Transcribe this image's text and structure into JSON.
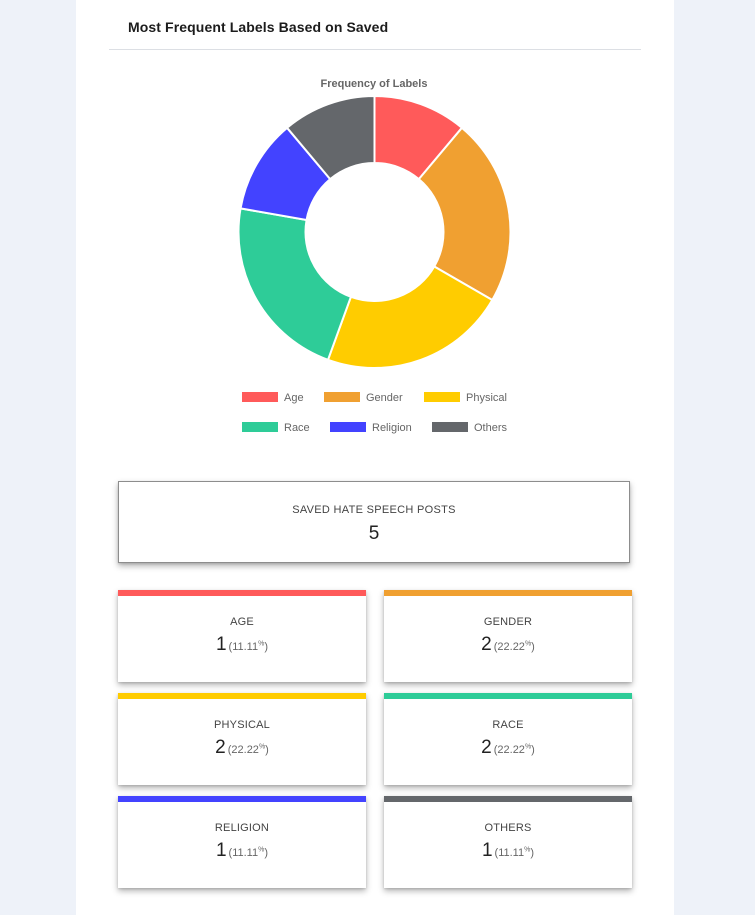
{
  "panel": {
    "title": "Most Frequent Labels Based on Saved"
  },
  "chart_data": {
    "type": "pie",
    "variant": "donut",
    "title": "Frequency of Labels",
    "labels": [
      "Age",
      "Gender",
      "Physical",
      "Race",
      "Religion",
      "Others"
    ],
    "values": [
      1,
      2,
      2,
      2,
      1,
      1
    ],
    "colors": [
      "#ff5a5a",
      "#f0a031",
      "#ffcc00",
      "#2ecc98",
      "#4343ff",
      "#64676b"
    ],
    "legend_position": "bottom"
  },
  "total": {
    "label": "SAVED HATE SPEECH POSTS",
    "value": "5"
  },
  "stats": [
    {
      "label": "AGE",
      "count": "1",
      "pct": "(11.11",
      "pct_suffix": "%",
      "pct_close": ")",
      "color": "#ff5a5a"
    },
    {
      "label": "GENDER",
      "count": "2",
      "pct": "(22.22",
      "pct_suffix": "%",
      "pct_close": ")",
      "color": "#f0a031"
    },
    {
      "label": "PHYSICAL",
      "count": "2",
      "pct": "(22.22",
      "pct_suffix": "%",
      "pct_close": ")",
      "color": "#ffcc00"
    },
    {
      "label": "RACE",
      "count": "2",
      "pct": "(22.22",
      "pct_suffix": "%",
      "pct_close": ")",
      "color": "#2ecc98"
    },
    {
      "label": "RELIGION",
      "count": "1",
      "pct": "(11.11",
      "pct_suffix": "%",
      "pct_close": ")",
      "color": "#4343ff"
    },
    {
      "label": "OTHERS",
      "count": "1",
      "pct": "(11.11",
      "pct_suffix": "%",
      "pct_close": ")",
      "color": "#64676b"
    }
  ]
}
